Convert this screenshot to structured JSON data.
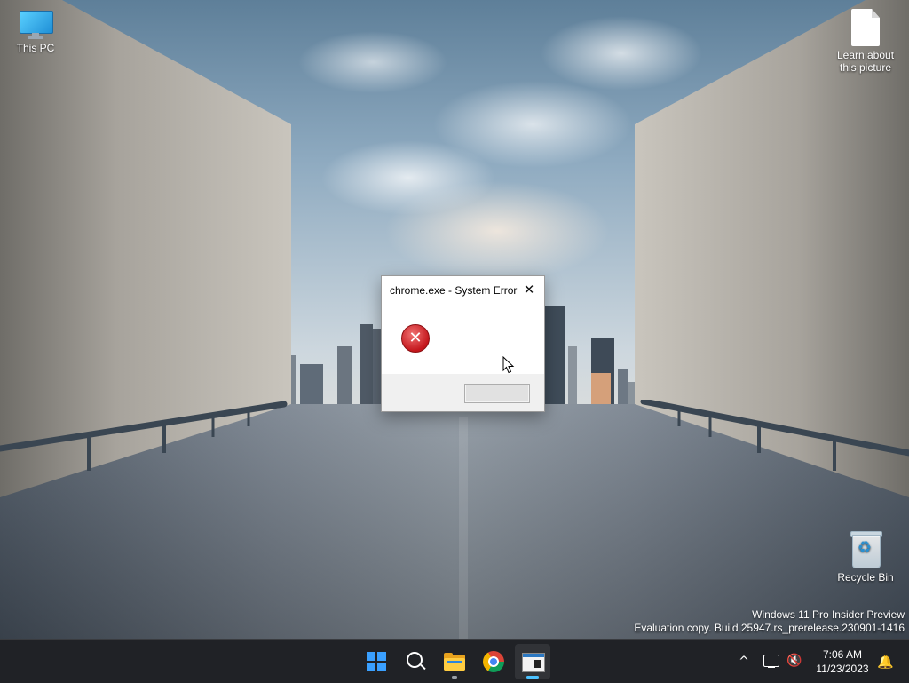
{
  "desktop": {
    "icons": {
      "this_pc": "This PC",
      "learn_about": "Learn about this picture",
      "recycle_bin": "Recycle Bin"
    }
  },
  "dialog": {
    "title": "chrome.exe - System Error",
    "close_glyph": "✕",
    "error_glyph": "✕",
    "button_label": ""
  },
  "watermark": {
    "line1": "Windows 11 Pro Insider Preview",
    "line2": "Evaluation copy. Build 25947.rs_prerelease.230901-1416"
  },
  "taskbar": {
    "apps": [
      "start",
      "search",
      "file-explorer",
      "chrome",
      "error-app"
    ],
    "active_app": "error-app",
    "accent_color": "#4cc2ff",
    "tray": {
      "chevron_glyph": "^",
      "volume_glyph": "🔇",
      "bell_glyph": "🔔",
      "time": "7:06 AM",
      "date": "11/23/2023"
    }
  }
}
